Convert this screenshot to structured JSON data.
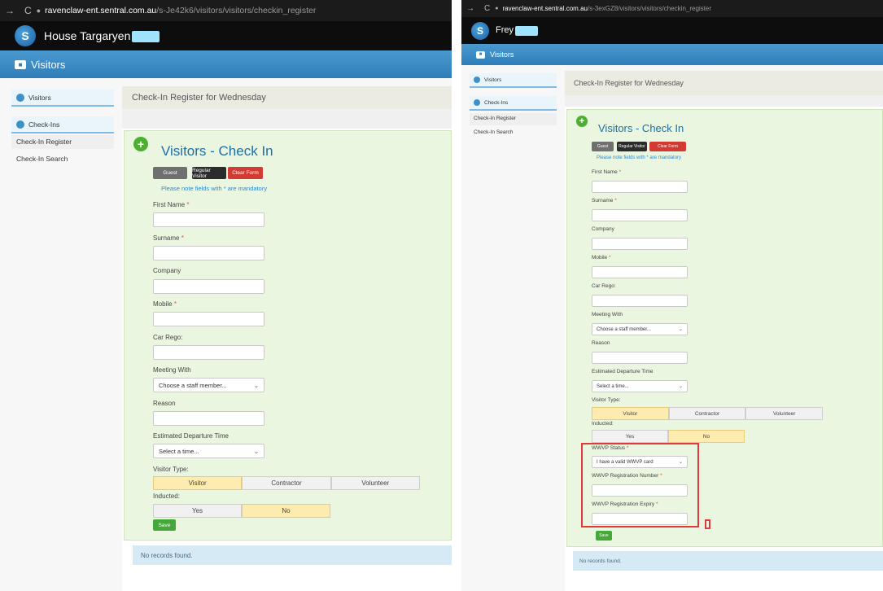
{
  "left": {
    "nav_back": "→",
    "nav_reload": "C",
    "url_host": "ravenclaw-ent.sentral.com.au",
    "url_path": "/s-Je42k6/visitors/visitors/checkin_register",
    "logo": "S",
    "school_name": "House Targaryen",
    "module": "Visitors",
    "sidebar": {
      "visitors": "Visitors",
      "checkins": "Check-Ins",
      "register": "Check-In Register",
      "search": "Check-In Search"
    },
    "breadcrumb": "Check-In Register for Wednesday",
    "form_title": "Visitors - Check In",
    "buttons": {
      "guest": "Guest",
      "regular": "Regular Visitor",
      "clear": "Clear Form"
    },
    "note": "Please note fields with * are mandatory",
    "labels": {
      "first_name": "First Name",
      "surname": "Surname",
      "company": "Company",
      "mobile": "Mobile",
      "car_rego": "Car Rego:",
      "meeting_with": "Meeting With",
      "reason": "Reason",
      "departure": "Estimated Departure Time",
      "visitor_type": "Visitor Type:",
      "inducted": "Inducted:"
    },
    "required_mark": "*",
    "meeting_select": "Choose a staff member...",
    "departure_select": "Select a time...",
    "visitor_types": [
      "Visitor",
      "Contractor",
      "Volunteer"
    ],
    "inducted_options": [
      "Yes",
      "No"
    ],
    "save": "Save",
    "records": "No records found."
  },
  "right": {
    "nav_back": "→",
    "nav_reload": "C",
    "url_host": "ravenclaw-ent.sentral.com.au",
    "url_path": "/s-3exGZ8/visitors/visitors/checkin_register",
    "logo": "S",
    "school_name": "Frey",
    "module": "Visitors",
    "sidebar": {
      "visitors": "Visitors",
      "checkins": "Check-Ins",
      "register": "Check-In Register",
      "search": "Check-In Search"
    },
    "breadcrumb": "Check-In Register for Wednesday",
    "form_title": "Visitors - Check In",
    "buttons": {
      "guest": "Guest",
      "regular": "Regular Visitor",
      "clear": "Clear Form"
    },
    "note": "Please note fields with * are mandatory",
    "labels": {
      "first_name": "First Name",
      "surname": "Surname",
      "company": "Company",
      "mobile": "Mobile",
      "car_rego": "Car Rego:",
      "meeting_with": "Meeting With",
      "reason": "Reason",
      "departure": "Estimated Departure Time",
      "visitor_type": "Visitor Type:",
      "inducted": "Inducted:",
      "wwvp_status": "WWVP Status",
      "wwvp_number": "WWVP Registration Number",
      "wwvp_expiry": "WWVP Registration Expiry"
    },
    "required_mark": "*",
    "meeting_select": "Choose a staff member...",
    "departure_select": "Select a time...",
    "wwvp_select": "I have a valid WWVP card",
    "visitor_types": [
      "Visitor",
      "Contractor",
      "Volunteer"
    ],
    "inducted_options": [
      "Yes",
      "No"
    ],
    "save": "Save",
    "records": "No records found."
  },
  "colors": {
    "accent_blue": "#2f7db8",
    "form_green": "#eaf6df",
    "selected_segment": "#fdebb0",
    "clear_red": "#d23b32",
    "save_green": "#46a83a",
    "annotation_red": "#e03a3a"
  }
}
